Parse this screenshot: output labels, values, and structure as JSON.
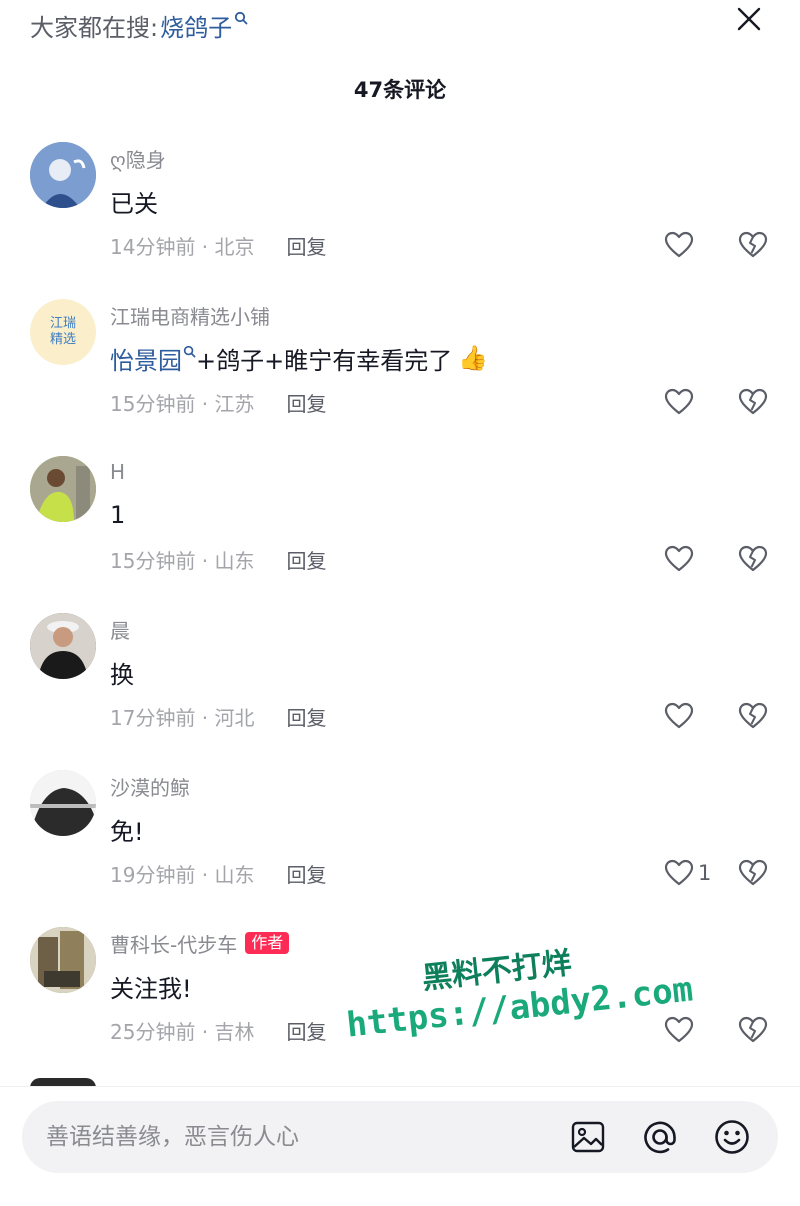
{
  "header": {
    "search_prefix": "大家都在搜:",
    "search_keyword": "烧鸽子",
    "comment_count": "47条评论"
  },
  "comments": [
    {
      "username": "ღ隐身",
      "content": "已关",
      "meta": "14分钟前 · 北京",
      "reply_label": "回复",
      "like_count": "",
      "avatar_bg": "#6f93c6"
    },
    {
      "username": "江瑞电商精选小铺",
      "avatar_text": "江瑞精选",
      "content_link": "怡景园",
      "content": "+鸽子+睢宁有幸看完了",
      "content_emoji": "👍",
      "meta": "15分钟前 · 江苏",
      "reply_label": "回复",
      "like_count": "",
      "avatar_bg": "#fbeecb"
    },
    {
      "username": "H",
      "content": "1",
      "meta": "15分钟前 · 山东",
      "reply_label": "回复",
      "like_count": "",
      "avatar_bg": "#9fbd5a"
    },
    {
      "username": "晨",
      "content": "换",
      "meta": "17分钟前 · 河北",
      "reply_label": "回复",
      "like_count": "",
      "avatar_bg": "#5a4a44"
    },
    {
      "username": "沙漠的鲸",
      "content": "免!",
      "meta": "19分钟前 · 山东",
      "reply_label": "回复",
      "like_count": "1",
      "avatar_bg": "#cfcfcf"
    },
    {
      "username": "曹科长-代步车",
      "badge": "作者",
      "content": "关注我!",
      "meta": "25分钟前 · 吉林",
      "reply_label": "回复",
      "like_count": "",
      "avatar_bg": "#8a7a52"
    }
  ],
  "watermark": {
    "line1": "黑料不打烊",
    "line2": "https://abdy2.com"
  },
  "input": {
    "placeholder": "善语结善缘，恶言伤人心"
  },
  "icons": {
    "close": "close-icon",
    "search": "search-icon",
    "like": "heart-icon",
    "dislike": "broken-heart-icon",
    "image": "image-icon",
    "mention": "at-icon",
    "emoji": "smiley-icon"
  },
  "colors": {
    "link": "#2f5c9d",
    "author_badge": "#fe2c55",
    "watermark": "#1aa97a"
  }
}
